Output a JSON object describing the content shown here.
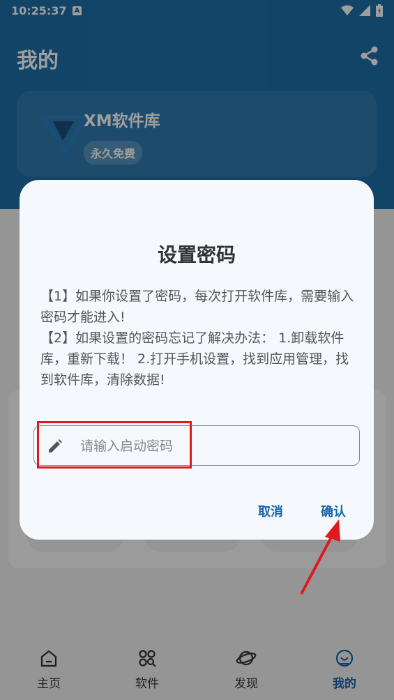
{
  "status_bar": {
    "time": "10:25:37",
    "notification_badge": "A",
    "icons": [
      "wifi-icon",
      "signal-icon",
      "battery-icon"
    ]
  },
  "header": {
    "title": "我的",
    "share_icon": "share-icon"
  },
  "profile": {
    "app_name": "XM软件库",
    "badge": "永久免费"
  },
  "dialog": {
    "title": "设置密码",
    "body_line1": "【1】如果你设置了密码，每次打开软件库，需要输入密码才能进入!",
    "body_line2": "【2】如果设置的密码忘记了解决办法： 1.卸载软件库，重新下载！ 2.打开手机设置，找到应用管理，找到软件库，清除数据!",
    "input_placeholder": "请输入启动密码",
    "input_value": "",
    "cancel_label": "取消",
    "confirm_label": "确认"
  },
  "bottom_nav": {
    "items": [
      {
        "label": "主页",
        "icon": "home-icon",
        "active": false
      },
      {
        "label": "软件",
        "icon": "apps-icon",
        "active": false
      },
      {
        "label": "发现",
        "icon": "planet-icon",
        "active": false
      },
      {
        "label": "我的",
        "icon": "profile-icon",
        "active": true
      }
    ]
  },
  "colors": {
    "header": "#1e6fa8",
    "accent": "#1565a8",
    "highlight": "#e0191a"
  }
}
